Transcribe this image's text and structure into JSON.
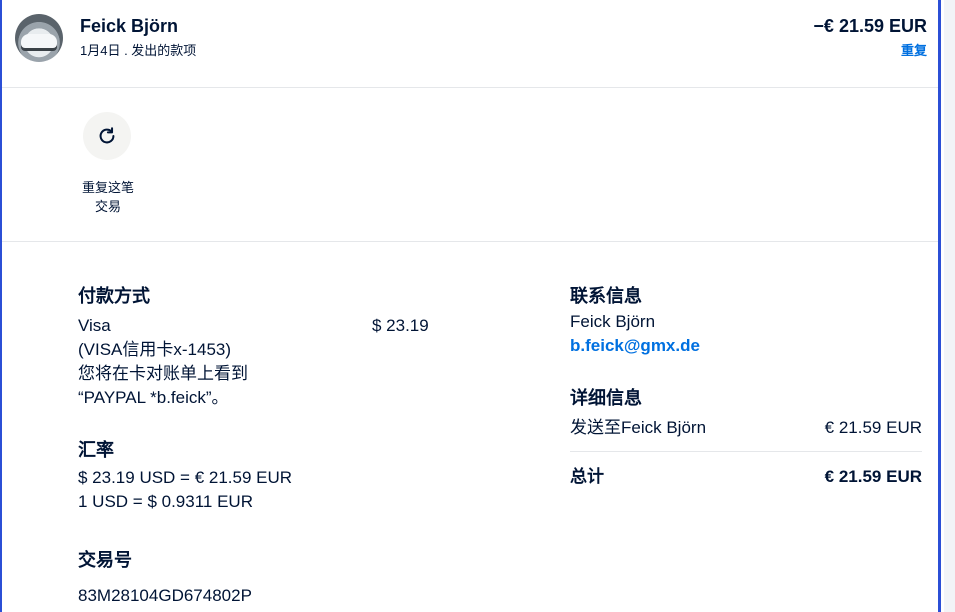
{
  "header": {
    "name": "Feick Björn",
    "subtitle": "1月4日 . 发出的款项",
    "amount": "−€ 21.59 EUR",
    "repeat_link": "重复"
  },
  "actions": {
    "repeat_label_line1": "重复这笔",
    "repeat_label_line2": "交易"
  },
  "payment_method": {
    "heading": "付款方式",
    "card": "Visa",
    "card_detail": "(VISA信用卡x-1453)",
    "statement_note_1": "您将在卡对账单上看到",
    "statement_note_2": "“PAYPAL *b.feick”。",
    "amount": "$ 23.19"
  },
  "exchange_rate": {
    "heading": "汇率",
    "line1": "$ 23.19 USD = € 21.59 EUR",
    "line2": "1 USD = $ 0.9311 EUR"
  },
  "transaction_id": {
    "heading": "交易号",
    "value": "83M28104GD674802P"
  },
  "contact": {
    "heading": "联系信息",
    "name": "Feick Björn",
    "email": "b.feick@gmx.de"
  },
  "details": {
    "heading": "详细信息",
    "sent_to_label": "发送至Feick Björn",
    "sent_to_amount": "€ 21.59 EUR",
    "total_label": "总计",
    "total_amount": "€ 21.59 EUR"
  },
  "colors": {
    "accent": "#0070e0",
    "text": "#001435",
    "frame": "#2b4fd6"
  }
}
